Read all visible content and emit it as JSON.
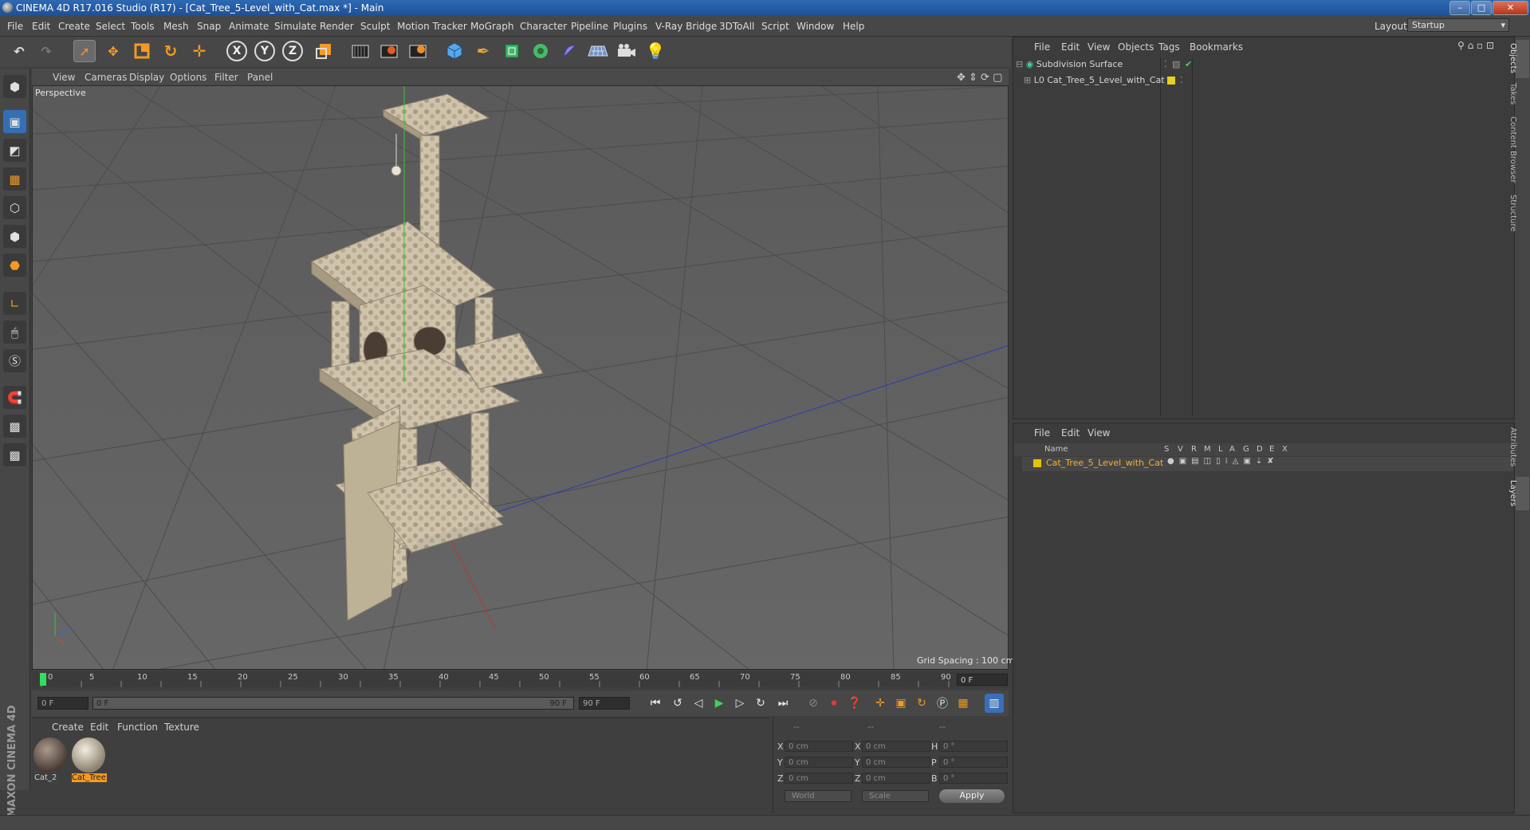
{
  "window": {
    "title": "CINEMA 4D R17.016 Studio (R17) - [Cat_Tree_5-Level_with_Cat.max *] - Main",
    "minimize": "–",
    "maximize": "□",
    "close": "✕"
  },
  "menubar": {
    "items": [
      "File",
      "Edit",
      "Create",
      "Select",
      "Tools",
      "Mesh",
      "Snap",
      "Animate",
      "Simulate",
      "Render",
      "Sculpt",
      "Motion Tracker",
      "MoGraph",
      "Character",
      "Pipeline",
      "Plugins",
      "V-Ray Bridge",
      "3DToAll",
      "Script",
      "Window",
      "Help"
    ],
    "layout_label": "Layout:",
    "layout_value": "Startup"
  },
  "toolbar": {
    "axis_x": "X",
    "axis_y": "Y",
    "axis_z": "Z"
  },
  "viewport": {
    "menu": [
      "View",
      "Cameras",
      "Display",
      "Options",
      "Filter",
      "Panel"
    ],
    "label": "Perspective",
    "grid_spacing": "Grid Spacing : 100 cm"
  },
  "timeline": {
    "ticks": [
      "0",
      "5",
      "10",
      "15",
      "20",
      "25",
      "30",
      "35",
      "40",
      "45",
      "50",
      "55",
      "60",
      "65",
      "70",
      "75",
      "80",
      "85",
      "90"
    ],
    "current_frame": "0 F",
    "start_field": "0 F",
    "range_start": "0 F",
    "range_end": "90 F",
    "end_field": "90 F"
  },
  "materials": {
    "menu": [
      "Create",
      "Edit",
      "Function",
      "Texture"
    ],
    "items": [
      {
        "label": "Cat_2"
      },
      {
        "label": "Cat_Tree"
      }
    ]
  },
  "coords": {
    "header_a": "--",
    "header_b": "--",
    "header_c": "--",
    "rows": [
      {
        "a_lbl": "X",
        "a_val": "0 cm",
        "b_lbl": "X",
        "b_val": "0 cm",
        "c_lbl": "H",
        "c_val": "0 °"
      },
      {
        "a_lbl": "Y",
        "a_val": "0 cm",
        "b_lbl": "Y",
        "b_val": "0 cm",
        "c_lbl": "P",
        "c_val": "0 °"
      },
      {
        "a_lbl": "Z",
        "a_val": "0 cm",
        "b_lbl": "Z",
        "b_val": "0 cm",
        "c_lbl": "B",
        "c_val": "0 °"
      }
    ],
    "world": "World",
    "scale": "Scale",
    "apply": "Apply"
  },
  "objects": {
    "menu": [
      "File",
      "Edit",
      "View",
      "Objects",
      "Tags",
      "Bookmarks"
    ],
    "items": [
      {
        "name": "Subdivision Surface"
      },
      {
        "name": "Cat_Tree_5_Level_with_Cat"
      }
    ]
  },
  "layers": {
    "menu": [
      "File",
      "Edit",
      "View"
    ],
    "header_name": "Name",
    "columns": [
      "S",
      "V",
      "R",
      "M",
      "L",
      "A",
      "G",
      "D",
      "E",
      "X"
    ],
    "items": [
      {
        "name": "Cat_Tree_5_Level_with_Cat",
        "color": "#e6c200"
      }
    ]
  },
  "right_tabs": [
    "Objects",
    "Takes",
    "Content Browser",
    "Structure",
    "Attributes",
    "Layers"
  ],
  "brand": "MAXON CINEMA 4D"
}
